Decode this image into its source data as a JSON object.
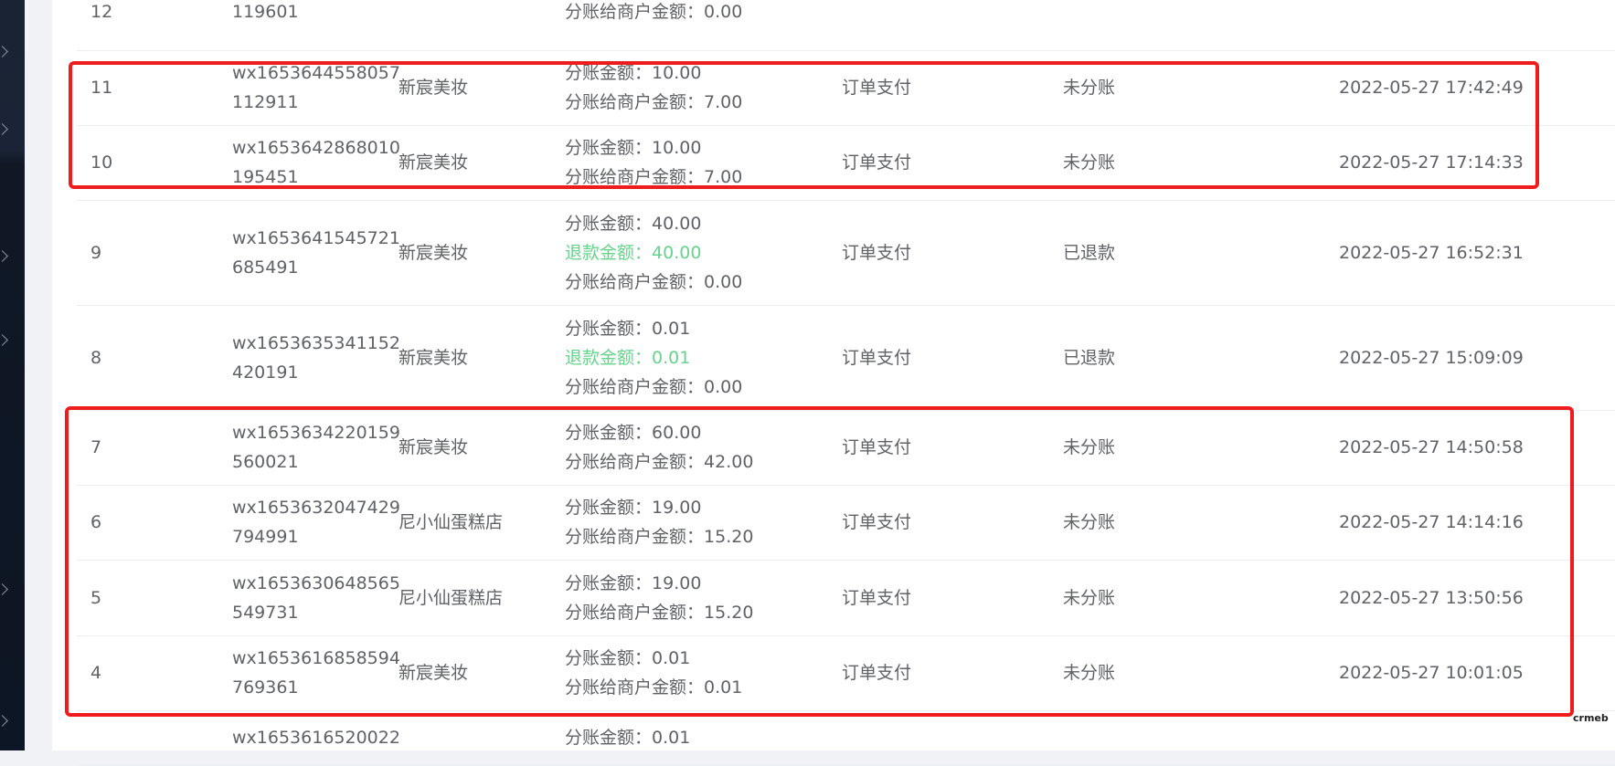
{
  "rows": [
    {
      "id": "12",
      "order_no": [
        "",
        "119601"
      ],
      "merchant": "",
      "amounts": [
        {
          "label": "",
          "value": "",
          "refund": true
        },
        {
          "label": "分账给商户金额：",
          "value": "0.00",
          "refund": false
        }
      ],
      "type": "",
      "status": "",
      "time": ""
    },
    {
      "id": "11",
      "order_no": [
        "wx1653644558057",
        "112911"
      ],
      "merchant": "新宸美妆",
      "amounts": [
        {
          "label": "分账金额：",
          "value": "10.00",
          "refund": false
        },
        {
          "label": "分账给商户金额：",
          "value": "7.00",
          "refund": false
        }
      ],
      "type": "订单支付",
      "status": "未分账",
      "time": "2022-05-27 17:42:49"
    },
    {
      "id": "10",
      "order_no": [
        "wx1653642868010",
        "195451"
      ],
      "merchant": "新宸美妆",
      "amounts": [
        {
          "label": "分账金额：",
          "value": "10.00",
          "refund": false
        },
        {
          "label": "分账给商户金额：",
          "value": "7.00",
          "refund": false
        }
      ],
      "type": "订单支付",
      "status": "未分账",
      "time": "2022-05-27 17:14:33"
    },
    {
      "id": "9",
      "order_no": [
        "wx1653641545721",
        "685491"
      ],
      "merchant": "新宸美妆",
      "amounts": [
        {
          "label": "分账金额：",
          "value": "40.00",
          "refund": false
        },
        {
          "label": "退款金额：",
          "value": "40.00",
          "refund": true
        },
        {
          "label": "分账给商户金额：",
          "value": "0.00",
          "refund": false
        }
      ],
      "type": "订单支付",
      "status": "已退款",
      "time": "2022-05-27 16:52:31"
    },
    {
      "id": "8",
      "order_no": [
        "wx1653635341152",
        "420191"
      ],
      "merchant": "新宸美妆",
      "amounts": [
        {
          "label": "分账金额：",
          "value": "0.01",
          "refund": false
        },
        {
          "label": "退款金额：",
          "value": "0.01",
          "refund": true
        },
        {
          "label": "分账给商户金额：",
          "value": "0.00",
          "refund": false
        }
      ],
      "type": "订单支付",
      "status": "已退款",
      "time": "2022-05-27 15:09:09"
    },
    {
      "id": "7",
      "order_no": [
        "wx1653634220159",
        "560021"
      ],
      "merchant": "新宸美妆",
      "amounts": [
        {
          "label": "分账金额：",
          "value": "60.00",
          "refund": false
        },
        {
          "label": "分账给商户金额：",
          "value": "42.00",
          "refund": false
        }
      ],
      "type": "订单支付",
      "status": "未分账",
      "time": "2022-05-27 14:50:58"
    },
    {
      "id": "6",
      "order_no": [
        "wx1653632047429",
        "794991"
      ],
      "merchant": "尼小仙蛋糕店",
      "amounts": [
        {
          "label": "分账金额：",
          "value": "19.00",
          "refund": false
        },
        {
          "label": "分账给商户金额：",
          "value": "15.20",
          "refund": false
        }
      ],
      "type": "订单支付",
      "status": "未分账",
      "time": "2022-05-27 14:14:16"
    },
    {
      "id": "5",
      "order_no": [
        "wx1653630648565",
        "549731"
      ],
      "merchant": "尼小仙蛋糕店",
      "amounts": [
        {
          "label": "分账金额：",
          "value": "19.00",
          "refund": false
        },
        {
          "label": "分账给商户金额：",
          "value": "15.20",
          "refund": false
        }
      ],
      "type": "订单支付",
      "status": "未分账",
      "time": "2022-05-27 13:50:56"
    },
    {
      "id": "4",
      "order_no": [
        "wx1653616858594",
        "769361"
      ],
      "merchant": "新宸美妆",
      "amounts": [
        {
          "label": "分账金额：",
          "value": "0.01",
          "refund": false
        },
        {
          "label": "分账给商户金额：",
          "value": "0.01",
          "refund": false
        }
      ],
      "type": "订单支付",
      "status": "未分账",
      "time": "2022-05-27 10:01:05"
    },
    {
      "id": "",
      "order_no": [
        "wx1653616520022",
        ""
      ],
      "merchant": "",
      "amounts": [
        {
          "label": "分账金额：",
          "value": "0.01",
          "refund": false
        }
      ],
      "type": "",
      "status": "",
      "time": ""
    }
  ],
  "watermark": "crmeb",
  "colors": {
    "highlight": "#ee1c1c",
    "refund": "#67d48d",
    "text": "#606266",
    "sidebar": "#0d1624"
  }
}
